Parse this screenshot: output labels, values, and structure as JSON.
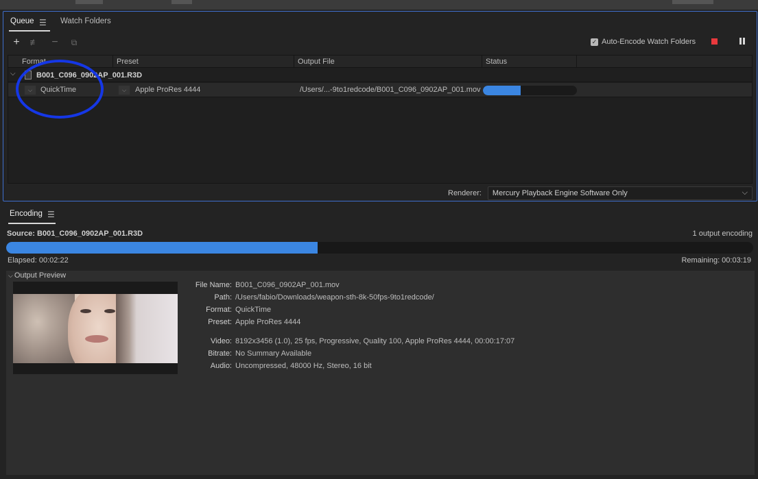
{
  "queue": {
    "tab_queue": "Queue",
    "tab_watch": "Watch Folders",
    "auto_encode_label": "Auto-Encode Watch Folders",
    "columns": [
      "Format",
      "Preset",
      "Output File",
      "Status"
    ],
    "source_name": "B001_C096_0902AP_001.R3D",
    "output": {
      "format": "QuickTime",
      "preset": "Apple ProRes 4444",
      "output_file": "/Users/...-9to1redcode/B001_C096_0902AP_001.mov",
      "progress": 0.4
    },
    "renderer_label": "Renderer:",
    "renderer_value": "Mercury Playback Engine Software Only"
  },
  "encoding": {
    "tab": "Encoding",
    "source": "Source: B001_C096_0902AP_001.R3D",
    "output_count": "1 output encoding",
    "progress": 0.417,
    "elapsed": "Elapsed: 00:02:22",
    "remaining": "Remaining: 00:03:19",
    "preview_header": "Output Preview",
    "file_name_label": "File Name:",
    "file_name": "B001_C096_0902AP_001.mov",
    "path_label": "Path:",
    "path": "/Users/fabio/Downloads/weapon-sth-8k-50fps-9to1redcode/",
    "format_label": "Format:",
    "format": "QuickTime",
    "preset_label": "Preset:",
    "preset": "Apple ProRes 4444",
    "video_label": "Video:",
    "video": "8192x3456 (1.0), 25 fps, Progressive, Quality 100, Apple ProRes 4444, 00:00:17:07",
    "bitrate_label": "Bitrate:",
    "bitrate": "No Summary Available",
    "audio_label": "Audio:",
    "audio": "Uncompressed, 48000 Hz, Stereo, 16 bit"
  },
  "colors": {
    "accent": "#3b86e2",
    "stop": "#e8393d",
    "annotation": "#1537e6"
  }
}
